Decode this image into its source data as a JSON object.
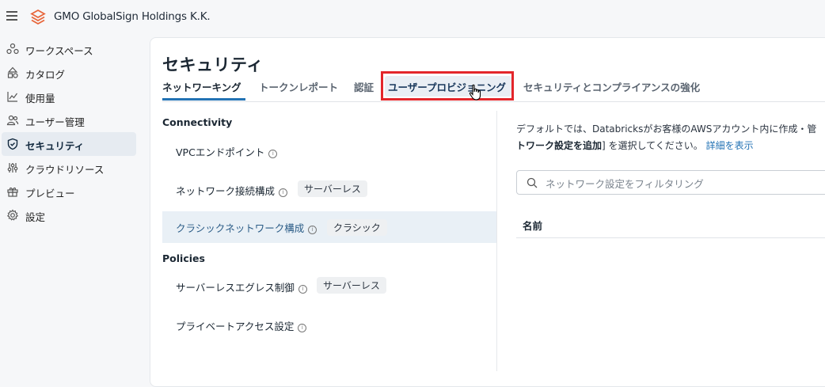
{
  "header": {
    "org_name": "GMO GlobalSign Holdings K.K."
  },
  "sidebar": {
    "items": [
      {
        "label": "ワークスペース",
        "icon": "workspace-icon"
      },
      {
        "label": "カタログ",
        "icon": "catalog-icon"
      },
      {
        "label": "使用量",
        "icon": "usage-chart-icon"
      },
      {
        "label": "ユーザー管理",
        "icon": "users-icon"
      },
      {
        "label": "セキュリティ",
        "icon": "shield-icon",
        "active": true
      },
      {
        "label": "クラウドリソース",
        "icon": "sliders-icon"
      },
      {
        "label": "プレビュー",
        "icon": "gift-icon"
      },
      {
        "label": "設定",
        "icon": "gear-icon"
      }
    ]
  },
  "page": {
    "title": "セキュリティ",
    "tabs": [
      {
        "label": "ネットワーキング",
        "active": true
      },
      {
        "label": "トークンレポート"
      },
      {
        "label": "認証"
      },
      {
        "label": "ユーザープロビジョニング",
        "highlighted": true
      },
      {
        "label": "セキュリティとコンプライアンスの強化"
      }
    ]
  },
  "left": {
    "connectivity_header": "Connectivity",
    "policies_header": "Policies",
    "items": [
      {
        "name": "VPCエンドポイント",
        "badge": ""
      },
      {
        "name": "ネットワーク接続構成",
        "badge": "サーバーレス"
      },
      {
        "name": "クラシックネットワーク構成",
        "badge": "クラシック",
        "selected": true
      },
      {
        "name": "サーバーレスエグレス制御",
        "badge": "サーバーレス"
      },
      {
        "name": "プライベートアクセス設定",
        "badge": ""
      }
    ]
  },
  "right": {
    "desc_line1": "デフォルトでは、Databricksがお客様のAWSアカウント内に作成・管",
    "desc_bold": "トワーク設定を追加",
    "desc_after": "] を選択してください。",
    "desc_link": "詳細を表示",
    "search_placeholder": "ネットワーク設定をフィルタリング",
    "column_name": "名前"
  },
  "colors": {
    "accent": "#2272b4",
    "highlight_box": "#e3262b",
    "active_nav_bg": "#e6ebf1"
  }
}
